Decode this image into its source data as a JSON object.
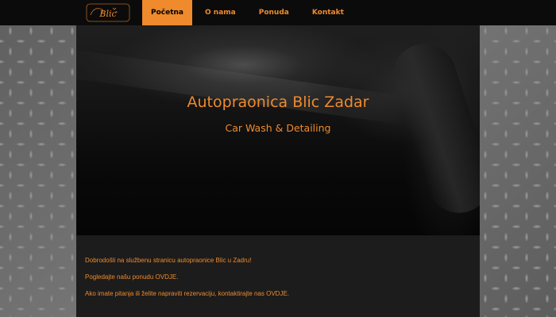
{
  "brand": {
    "logo_text": "Blic",
    "accent_color": "#ef8a2d"
  },
  "nav": {
    "items": [
      {
        "label": "Početna",
        "active": true
      },
      {
        "label": "O nama",
        "active": false
      },
      {
        "label": "Ponuda",
        "active": false
      },
      {
        "label": "Kontakt",
        "active": false
      }
    ]
  },
  "hero": {
    "title": "Autopraonica Blic Zadar",
    "subtitle": "Car Wash & Detailing"
  },
  "content": {
    "welcome": "Dobrodošli na službenu stranicu autopraonice Blic u Zadru!",
    "offer_prefix": "Pogledajte našu ponudu ",
    "offer_link": "OVDJE",
    "offer_suffix": ".",
    "contact_prefix": "Ako imate pitanja ili želite napraviti rezervaciju, kontaktirajte nas ",
    "contact_link": "OVDJE",
    "contact_suffix": "."
  }
}
